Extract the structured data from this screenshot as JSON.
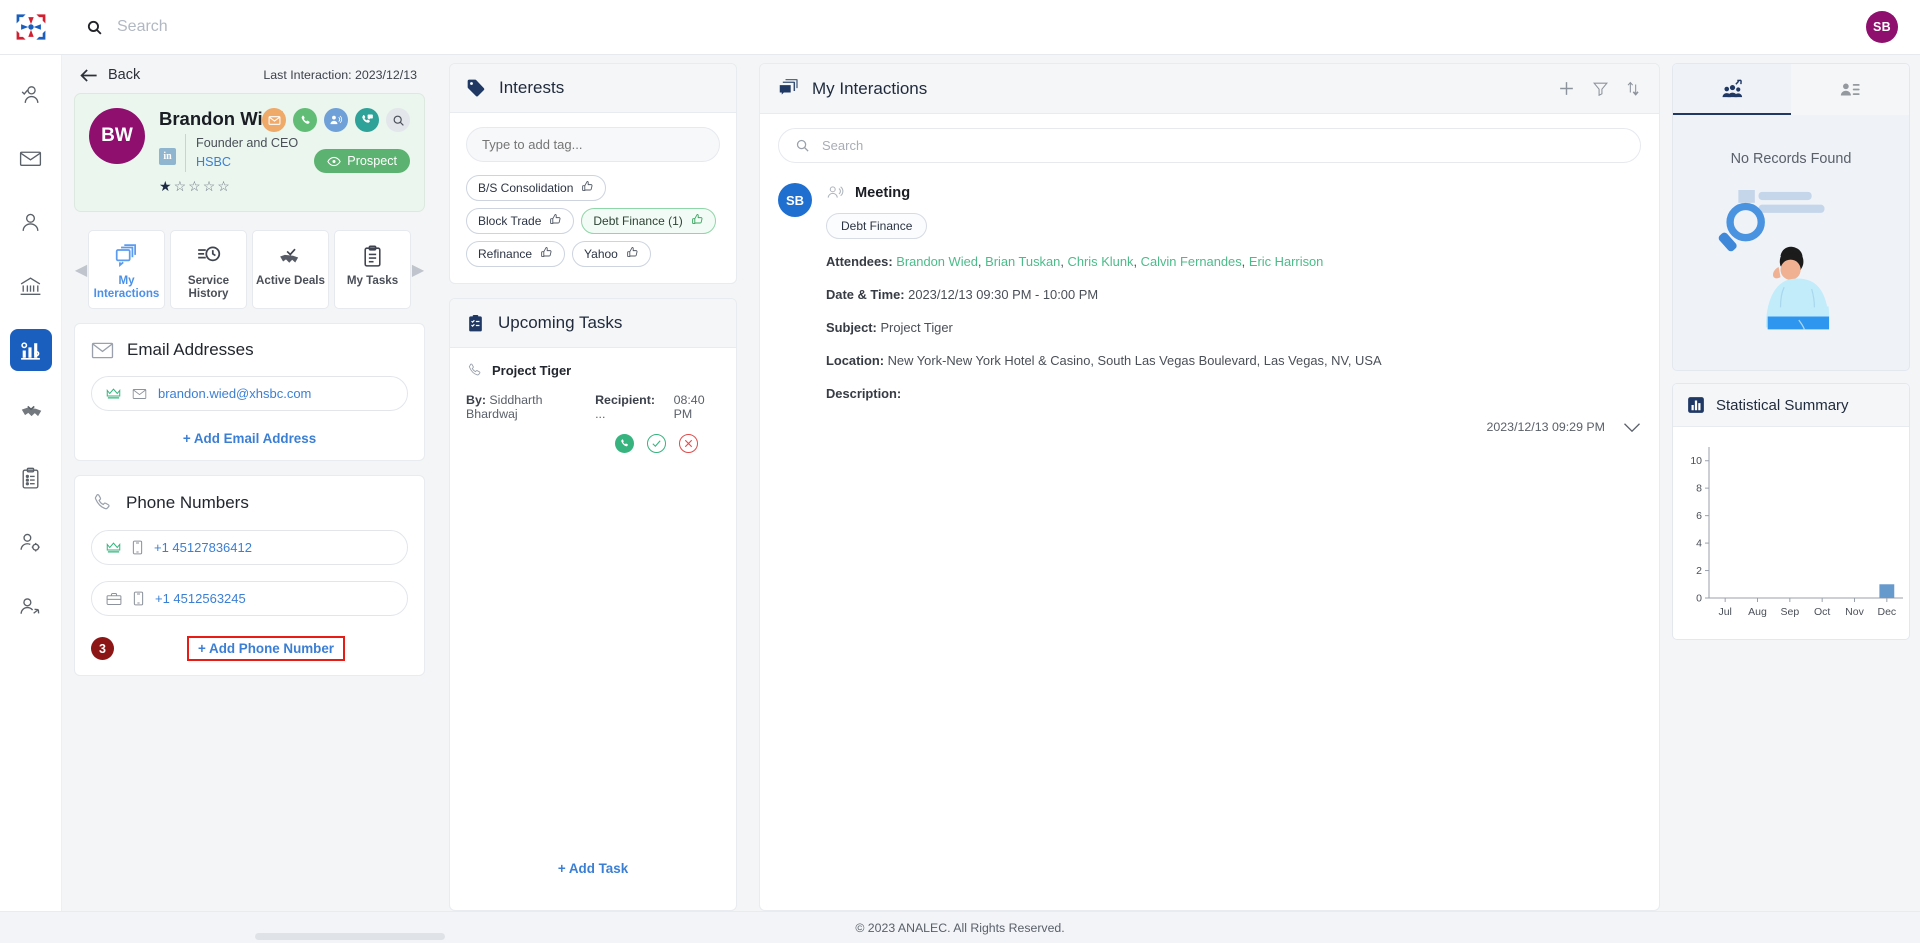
{
  "topbar": {
    "search_placeholder": "Search",
    "user_initials": "SB",
    "logo_name": "analec-logo"
  },
  "rail": {
    "items": [
      {
        "name": "user-check-icon",
        "label": "Approvals"
      },
      {
        "name": "mail-icon",
        "label": "Mail"
      },
      {
        "name": "contact-icon",
        "label": "Contacts"
      },
      {
        "name": "institution-icon",
        "label": "Institutions"
      },
      {
        "name": "analytics-icon",
        "label": "Analytics"
      },
      {
        "name": "handshake-icon",
        "label": "Deals"
      },
      {
        "name": "clipboard-icon",
        "label": "Tasks"
      },
      {
        "name": "user-settings-icon",
        "label": "User Settings"
      },
      {
        "name": "user-share-icon",
        "label": "Share"
      }
    ],
    "active_index": 4
  },
  "contact": {
    "back_label": "Back",
    "last_interaction_label": "Last Interaction: 2023/12/13",
    "initials": "BW",
    "name": "Brandon Wied",
    "linkedin_mark": "in",
    "title": "Founder and CEO",
    "company": "HSBC",
    "rating": 1,
    "rating_max": 5,
    "status_label": "Prospect",
    "action_icons": [
      {
        "name": "email-action-icon",
        "glyph": "✉"
      },
      {
        "name": "phone-action-icon",
        "glyph": "✆"
      },
      {
        "name": "conference-action-icon",
        "glyph": "὆5"
      },
      {
        "name": "video-call-action-icon",
        "glyph": "☎"
      },
      {
        "name": "search-action-icon",
        "glyph": "⌕"
      }
    ],
    "tabs": [
      {
        "label": "My Interactions",
        "icon": "interactions-icon",
        "active": true
      },
      {
        "label": "Service History",
        "icon": "service-history-icon",
        "active": false
      },
      {
        "label": "Active Deals",
        "icon": "active-deals-icon",
        "active": false
      },
      {
        "label": "My Tasks",
        "icon": "my-tasks-icon",
        "active": false
      }
    ],
    "email_section": {
      "title": "Email Addresses",
      "items": [
        {
          "value": "brandon.wied@xhsbc.com",
          "primary": true
        }
      ],
      "add_label": "+ Add Email Address"
    },
    "phone_section": {
      "title": "Phone Numbers",
      "items": [
        {
          "value": "+1 45127836412",
          "primary": true,
          "type": "mobile"
        },
        {
          "value": "+1 4512563245",
          "primary": false,
          "type": "work"
        }
      ],
      "add_label": "+ Add Phone Number",
      "step_badge": "3"
    }
  },
  "interests": {
    "title": "Interests",
    "input_placeholder": "Type to add tag...",
    "tags": [
      {
        "label": "B/S Consolidation",
        "liked": false
      },
      {
        "label": "Block Trade",
        "liked": false
      },
      {
        "label": "Debt Finance (1)",
        "liked": true
      },
      {
        "label": "Refinance",
        "liked": false
      },
      {
        "label": "Yahoo",
        "liked": false
      }
    ]
  },
  "upcoming_tasks": {
    "title": "Upcoming Tasks",
    "items": [
      {
        "subject": "Project Tiger",
        "by_label": "By:",
        "by_value": "Siddharth Bhardwaj",
        "recipient_label": "Recipient:",
        "recipient_value": "...",
        "time": "08:40 PM"
      }
    ],
    "add_label": "+ Add Task"
  },
  "interactions": {
    "title": "My Interactions",
    "search_placeholder": "Search",
    "items": [
      {
        "avatar": "SB",
        "type": "Meeting",
        "tag": "Debt Finance",
        "attendees_label": "Attendees:",
        "attendees": [
          "Brandon Wied",
          "Brian Tuskan",
          "Chris Klunk",
          "Calvin Fernandes",
          "Eric Harrison"
        ],
        "datetime_label": "Date & Time:",
        "datetime_value": "2023/12/13 09:30 PM - 10:00 PM",
        "subject_label": "Subject:",
        "subject_value": "Project Tiger",
        "location_label": "Location:",
        "location_value": "New York-New York Hotel & Casino, South Las Vegas Boulevard, Las Vegas, NV, USA",
        "description_label": "Description:",
        "description_value": "",
        "timestamp": "2023/12/13 09:29 PM"
      }
    ]
  },
  "right_panel": {
    "tabs": [
      {
        "name": "team-analytics-icon",
        "active": true
      },
      {
        "name": "contact-card-icon",
        "active": false
      }
    ],
    "empty_text": "No Records Found",
    "stat_title": "Statistical Summary"
  },
  "chart_data": {
    "type": "bar",
    "title": "Statistical Summary",
    "categories": [
      "Jul",
      "Aug",
      "Sep",
      "Oct",
      "Nov",
      "Dec"
    ],
    "values": [
      0,
      0,
      0,
      0,
      0,
      1
    ],
    "xlabel": "",
    "ylabel": "",
    "ylim": [
      0,
      11
    ],
    "yticks": [
      0,
      2,
      4,
      6,
      8,
      10
    ],
    "bar_color": "#6699cc",
    "grid": false,
    "legend": false
  },
  "footer": {
    "copyright": "© 2023 ANALEC. All Rights Reserved."
  },
  "colors": {
    "accent_blue": "#3b7fd4",
    "navy": "#1f3864",
    "green": "#5cb270",
    "magenta": "#8e0f6e",
    "highlight_red": "#e81b15",
    "badge_dark_red": "#8c1515"
  }
}
